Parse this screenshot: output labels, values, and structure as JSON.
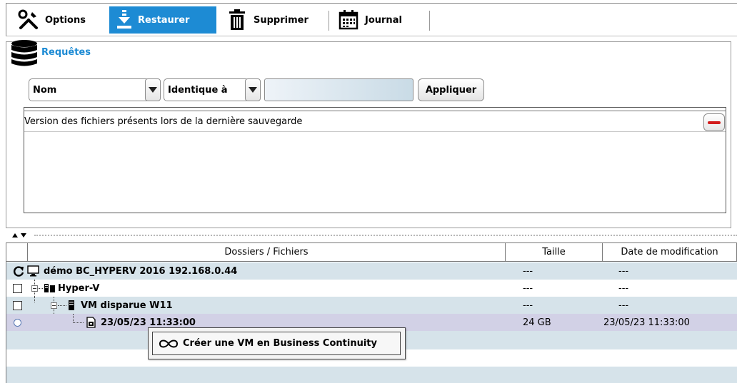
{
  "toolbar": {
    "options_label": "Options",
    "restore_label": "Restaurer",
    "delete_label": "Supprimer",
    "journal_label": "Journal"
  },
  "queries": {
    "title": "Requêtes",
    "field_select": "Nom",
    "operator_select": "Identique à",
    "value_input": "",
    "apply_label": "Appliquer",
    "rows": [
      "Version des fichiers présents lors de la dernière sauvegarde"
    ]
  },
  "table": {
    "headers": {
      "name": "Dossiers / Fichiers",
      "size": "Taille",
      "date": "Date de modification"
    },
    "rows": [
      {
        "name": "démo  BC_HYPERV 2016 192.168.0.44",
        "size": "---",
        "date": "---"
      },
      {
        "name": "Hyper-V",
        "size": "---",
        "date": "---"
      },
      {
        "name": "VM disparue W11",
        "size": "---",
        "date": "---"
      },
      {
        "name": "23/05/23 11:33:00",
        "size": "24 GB",
        "date": "23/05/23 11:33:00"
      }
    ]
  },
  "context_menu": {
    "item_label": "Créer une VM en Business Continuity"
  },
  "colors": {
    "accent": "#1d8bd4",
    "row_alt": "#d6e3ea",
    "row_selected": "#d2d1e6",
    "remove_red": "#d21b1b"
  },
  "icons": [
    "tools-icon",
    "download-icon",
    "trash-icon",
    "calendar-icon",
    "database-icon",
    "refresh-icon",
    "computer-icon",
    "server-icon",
    "vm-icon",
    "snapshot-icon",
    "infinity-icon"
  ]
}
